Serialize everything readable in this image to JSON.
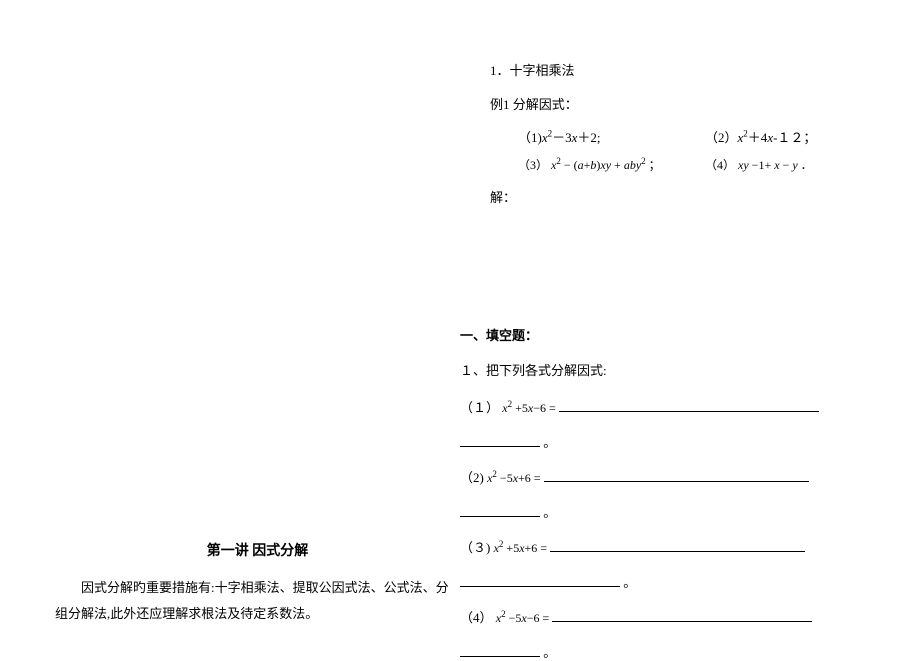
{
  "left_column": {
    "title": "第一讲  因式分解",
    "intro": "因式分解旳重要措施有:十字相乘法、提取公因式法、公式法、分组分解法,此外还应理解求根法及待定系数法。"
  },
  "section1": {
    "number": "1．",
    "title": "十字相乘法",
    "example_label": "例1  分解因式：",
    "items": {
      "p1_label": "（1)",
      "p1_expr": "x²－3x＋2;",
      "p2_label": "（2）",
      "p2_expr": "x²＋4x-１２；",
      "p3_label": "（3）",
      "p3_expr": "x²－(a＋b)xy＋aby²；",
      "p4_label": "（4）",
      "p4_expr": "xy－1+x－y．"
    },
    "solution_label": "解："
  },
  "exercises": {
    "heading": "一、填空题：",
    "q1_label": "１、把下列各式分解因式:",
    "items": {
      "p1_label": "（１）",
      "p1_expr": " x² +5x−6 = ",
      "p2_label": "（2)",
      "p2_expr": " x² −5x+6 = ",
      "p3_label": "（３)",
      "p3_expr": " x² +5x+6 = ",
      "p4_label": "（4）",
      "p4_expr": " x² −5x−6 = "
    },
    "end_mark": "。"
  }
}
